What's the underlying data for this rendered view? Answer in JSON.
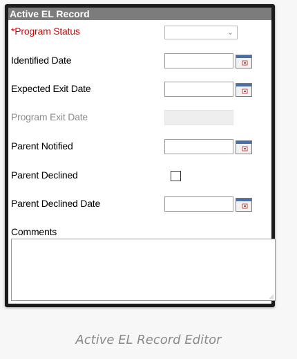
{
  "panel": {
    "title": "Active EL Record"
  },
  "fields": {
    "program_status": {
      "label": "*Program Status",
      "value": ""
    },
    "identified_date": {
      "label": "Identified Date",
      "value": ""
    },
    "expected_exit_date": {
      "label": "Expected Exit Date",
      "value": ""
    },
    "program_exit_date": {
      "label": "Program Exit Date",
      "value": ""
    },
    "parent_notified": {
      "label": "Parent Notified",
      "value": ""
    },
    "parent_declined": {
      "label": "Parent Declined",
      "checked": false
    },
    "parent_declined_date": {
      "label": "Parent Declined Date",
      "value": ""
    },
    "comments": {
      "label": "Comments",
      "value": ""
    }
  },
  "caption": "Active EL Record Editor",
  "icons": {
    "dropdown": "chevron-down-icon",
    "calendar": "calendar-icon",
    "resize": "resize-grip-icon"
  },
  "colors": {
    "header_bg": "#7c7c7c",
    "required_label": "#e00000",
    "disabled_label": "#8a8a8a"
  }
}
